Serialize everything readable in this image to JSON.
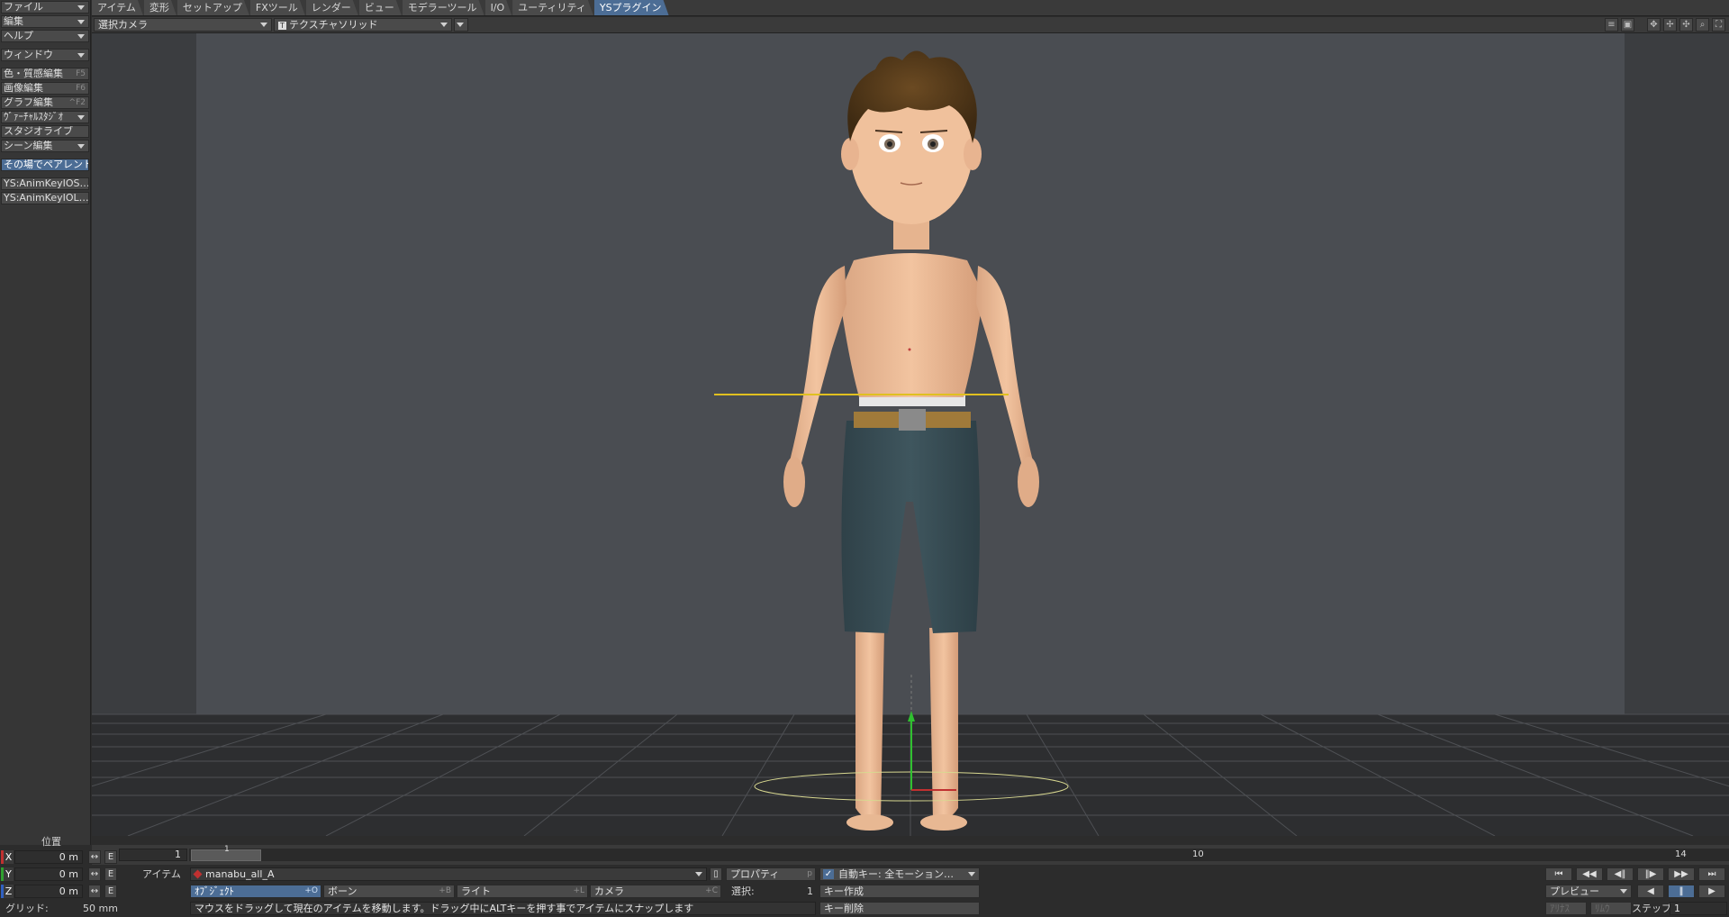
{
  "menu": {
    "tabs": [
      "アイテム",
      "変形",
      "セットアップ",
      "FXツール",
      "レンダー",
      "ビュー",
      "モデラーツール",
      "I/O",
      "ユーティリティ",
      "YSプラグイン"
    ],
    "active_index": 9
  },
  "sidebar": {
    "file": "ファイル",
    "edit": "編集",
    "help": "ヘルプ",
    "window": "ウィンドウ",
    "surface": "色・質感編集",
    "surface_key": "F5",
    "image": "画像編集",
    "image_key": "F6",
    "graph": "グラフ編集",
    "graph_key": "^F2",
    "virtual_studio": "ｳﾞｧｰﾁｬﾙｽﾀｼﾞｵ",
    "studio_live": "スタジオライブ",
    "scene_edit": "シーン編集",
    "reparent": "その場でペアレント",
    "plugin1": "YS:AnimKeyIOS…",
    "plugin2": "YS:AnimKeyIOL…",
    "position_label": "位置"
  },
  "viewport": {
    "camera": "選択カメラ",
    "render_mode": "テクスチャソリッド",
    "render_mode_icon": "T"
  },
  "timeline": {
    "start_frame": "1",
    "tick_10": "10",
    "end_frame": "14",
    "marker": "1"
  },
  "transform": {
    "x_label": "X",
    "y_label": "Y",
    "z_label": "Z",
    "x_value": "0 m",
    "y_value": "0 m",
    "z_value": "0 m",
    "e_label": "E",
    "grid_label": "グリッド:",
    "grid_value": "50 mm"
  },
  "item_panel": {
    "item_label": "アイテム",
    "current_item": "manabu_all_A",
    "properties": "プロパティ",
    "properties_key": "p",
    "object": "ｵﾌﾞｼﾞｪｸﾄ",
    "object_key": "+O",
    "bone": "ボーン",
    "bone_key": "+B",
    "light": "ライト",
    "light_key": "+L",
    "camera": "カメラ",
    "camera_key": "+C",
    "selected_label": "選択:",
    "selected_count": "1",
    "status": "マウスをドラッグして現在のアイテムを移動します。ドラッグ中にALTキーを押す事でアイテムにスナップします"
  },
  "key_panel": {
    "auto_key": "自動キー: 全モーション…",
    "create_key": "キー作成",
    "delete_key": "キー削除"
  },
  "playback": {
    "preview": "プレビュー",
    "step_label": "ステップ",
    "step_value": "1",
    "record_label": "ｱﾘﾅｽ",
    "remove_label": "ﾘﾑｳ"
  },
  "colors": {
    "accent": "#4c6d95",
    "x_axis": "#c03030",
    "y_axis": "#30a030",
    "z_axis": "#3060c0"
  }
}
